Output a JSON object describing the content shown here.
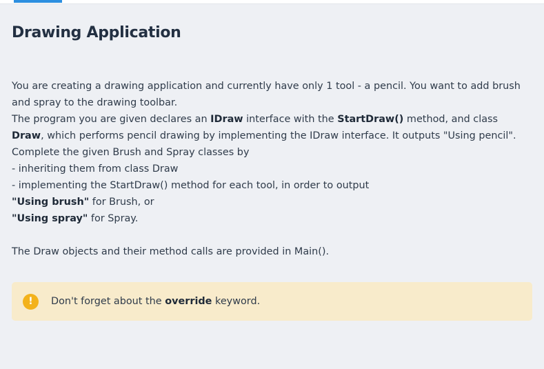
{
  "page": {
    "title": "Drawing Application"
  },
  "description": {
    "intro": "You are creating a drawing application and currently have only 1 tool - a pencil. You want to add brush and spray to the drawing toolbar.",
    "p2_a": "The program you are given declares an ",
    "p2_idraw": "IDraw",
    "p2_b": " interface with the ",
    "p2_startdraw": "StartDraw()",
    "p2_c": " method, and class ",
    "p2_draw": "Draw",
    "p2_d": ", which performs pencil drawing by implementing the IDraw interface. It outputs \"Using pencil\".",
    "p3": "Complete the given Brush and Spray classes by",
    "bullet1": "- inheriting them from class Draw",
    "bullet2": "- implementing the StartDraw() method for each tool, in order to output",
    "brush_bold": "\"Using brush\"",
    "brush_rest": " for Brush, or",
    "spray_bold": "\"Using spray\"",
    "spray_rest": " for Spray.",
    "footer": "The Draw objects and their method calls are provided in Main()."
  },
  "callout": {
    "icon": "exclamation-icon",
    "icon_glyph": "!",
    "icon_color": "#f3b21b",
    "background": "#f8ebcb",
    "text_a": "Don't forget about the ",
    "text_bold": "override",
    "text_b": " keyword."
  },
  "colors": {
    "accent": "#2d8fe0"
  }
}
